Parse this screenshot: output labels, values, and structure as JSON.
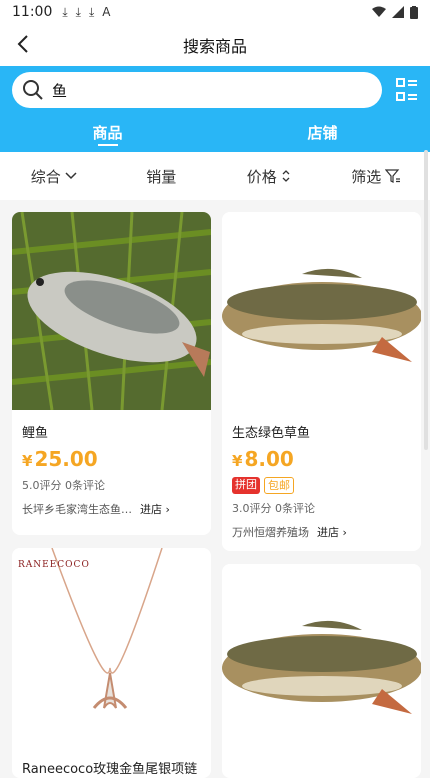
{
  "status": {
    "time": "11:00",
    "downloads": [
      "⤓",
      "⤓",
      "⤓"
    ],
    "indicator": "A"
  },
  "header": {
    "title": "搜索商品"
  },
  "search": {
    "value": "鱼"
  },
  "tabs": [
    {
      "label": "商品",
      "active": true
    },
    {
      "label": "店铺",
      "active": false
    }
  ],
  "sort": [
    {
      "label": "综合"
    },
    {
      "label": "销量"
    },
    {
      "label": "价格"
    },
    {
      "label": "筛选"
    }
  ],
  "products": [
    {
      "name": "鲤鱼",
      "yen": "¥",
      "price": "25.00",
      "rating": "5.0评分 0条评论",
      "shop": "长坪乡毛家湾生态鱼…",
      "enter": "进店"
    },
    {
      "name": "生态绿色草鱼",
      "yen": "¥",
      "price": "8.00",
      "badges": [
        "拼团",
        "包邮"
      ],
      "rating": "3.0评分 0条评论",
      "shop": "万州恒熠养殖场",
      "enter": "进店"
    },
    {
      "brand": "RANEECOCO",
      "name": "Raneecoco玫瑰金鱼尾银项链"
    },
    {
      "name": ""
    }
  ],
  "colors": {
    "accent": "#29b6f6",
    "price": "#f5a623",
    "badge_red": "#e5322d"
  }
}
